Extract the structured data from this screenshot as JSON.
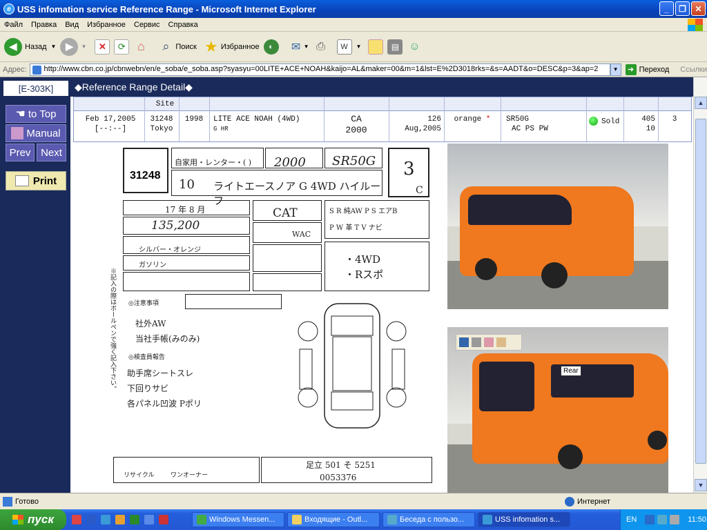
{
  "window": {
    "title": "USS infomation service Reference Range - Microsoft Internet Explorer",
    "controls": {
      "minimize": "_",
      "maximize": "❐",
      "close": "✕"
    }
  },
  "menu": [
    "Файл",
    "Правка",
    "Вид",
    "Избранное",
    "Сервис",
    "Справка"
  ],
  "toolbar": {
    "back_label": "Назад",
    "search_label": "Поиск",
    "favorites_label": "Избранное"
  },
  "address": {
    "label": "Адрес:",
    "url": "http://www.cbn.co.jp/cbnwebn/en/e_soba/e_soba.asp?syasyu=00LITE+ACE+NOAH&kaijo=AL&maker=00&m=1&lst=E%2D3018rks=&s=AADT&o=DESC&p=3&ap=2",
    "go_label": "Переход",
    "links_label": "Ссылки"
  },
  "page": {
    "tab_label": "[E-303K]",
    "title": "◆Reference Range Detail◆",
    "nav": {
      "to_top": "to Top",
      "manual": "Manual",
      "prev": "Prev",
      "next": "Next",
      "print": "Print"
    }
  },
  "listing": {
    "header_site": "Site",
    "date": "Feb 17,2005",
    "date_sub": "[--:--]",
    "lot_no": "31248",
    "site": "Tokyo",
    "year": "1998",
    "model": "LITE ACE NOAH (4WD)",
    "grade": "G HR",
    "engine_code": "CA",
    "engine_cc": "2000",
    "mileage": "126",
    "inspection": "Aug,2005",
    "color": "orange",
    "color_mark": "*",
    "chassis": "SR50G",
    "equipment": "AC PS PW",
    "result": "Sold",
    "price": "405",
    "price_sub": "10",
    "score": "3"
  },
  "sheet": {
    "lot_no": "31248",
    "displacement": "2000",
    "model_code": "SR50G",
    "score": "3",
    "interior": "C",
    "reg_year": "10",
    "model_hw": "ライトエースノア G 4WD ハイルーフ",
    "inspect_hw": "17 年  8 月",
    "mileage_hw": "135,200",
    "shift": "CAT",
    "ac": "WAC",
    "color_hw": "シルバー・オレンジ",
    "fuel_hw": "ガソリン",
    "points": "・4WD\n・Rスポ",
    "notes_hw": "社外AW\n当社手帳(みのみ)",
    "inspect_notes": "助手席シートスレ\n下回りサビ\n各パネル凹波 Pポリ",
    "reg_no": "足立 501 そ 5251",
    "frame_no": "0053376",
    "label_recycle": "リサイクル",
    "label_owner": "ワンオーナー"
  },
  "photos": {
    "rear_label": "Rear"
  },
  "status": {
    "left": "Готово",
    "zone": "Интернет"
  },
  "taskbar": {
    "start": "пуск",
    "tasks": [
      "Windows Messen...",
      "Входящие - Outl...",
      "Беседа с пользо...",
      "USS infomation s..."
    ],
    "lang": "EN",
    "clock": "11:50"
  }
}
